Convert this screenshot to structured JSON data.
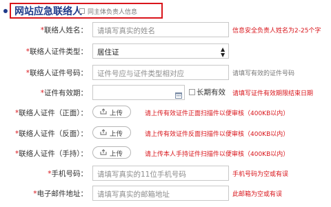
{
  "section": {
    "title": "网站应急联络人",
    "same_as_owner": "同主体负责人信息"
  },
  "fields": {
    "name": {
      "label": "*联络人姓名：",
      "placeholder": "请填写真实的姓名",
      "hint": "信息安全负责人姓名为2-25个字"
    },
    "id_type": {
      "label": "*联络人证件类型：",
      "value": "居住证"
    },
    "id_number": {
      "label": "*联络人证件号码：",
      "placeholder": "证件号应与证件类型相对应",
      "hint": "请填写有效的证件号码"
    },
    "validity": {
      "label": "*证件有效期：",
      "long_term": "长期有效",
      "hint": "请填写证件有效期限结束日期"
    },
    "id_front": {
      "label": "*联络人证件（正面）：",
      "button": "上传",
      "hint": "请上传有效证件正面扫描件以便审核（400KB以内）"
    },
    "id_back": {
      "label": "*联络人证件（反面）：",
      "button": "上传",
      "hint": "请上传有效证件反面扫描件以便审核（400KB以内）"
    },
    "id_handheld": {
      "label": "*联络人证件（手持）：",
      "button": "上传",
      "hint": "请上传本人手持证件扫描件以便审核（400KB以内）"
    },
    "mobile": {
      "label": "*手机号码：",
      "placeholder": "请填写真实的11位手机号码",
      "hint": "手机号码为空或有误"
    },
    "email": {
      "label": "*电子邮件地址：",
      "placeholder": "请填写真实的邮箱地址",
      "hint": "此邮箱为空或有误"
    }
  },
  "colors": {
    "accent_red": "#d9151b",
    "title_blue": "#1f3a8a"
  },
  "icons": {
    "upload": "upload-icon",
    "calendar": "calendar-icon",
    "select_arrow": "up-down-arrow-icon"
  }
}
